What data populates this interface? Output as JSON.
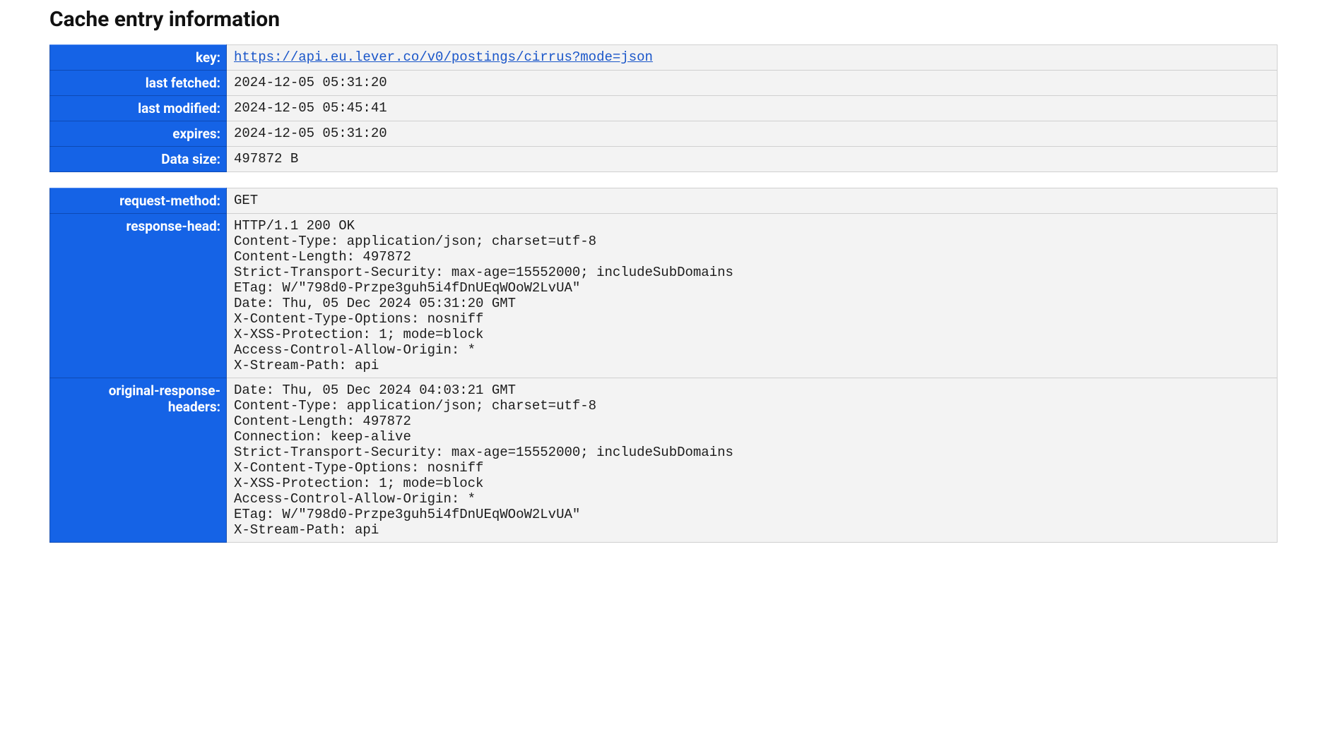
{
  "title": "Cache entry information",
  "entry": {
    "rows": [
      {
        "label": "key:",
        "value": "https://api.eu.lever.co/v0/postings/cirrus?mode=json",
        "is_link": true
      },
      {
        "label": "last fetched:",
        "value": "2024-12-05 05:31:20"
      },
      {
        "label": "last modified:",
        "value": "2024-12-05 05:45:41"
      },
      {
        "label": "expires:",
        "value": "2024-12-05 05:31:20"
      },
      {
        "label": "Data size:",
        "value": "497872 B"
      }
    ]
  },
  "meta": {
    "rows": [
      {
        "label": "request-method:",
        "value": "GET"
      },
      {
        "label": "response-head:",
        "value": "HTTP/1.1 200 OK\nContent-Type: application/json; charset=utf-8\nContent-Length: 497872\nStrict-Transport-Security: max-age=15552000; includeSubDomains\nETag: W/\"798d0-Przpe3guh5i4fDnUEqWOoW2LvUA\"\nDate: Thu, 05 Dec 2024 05:31:20 GMT\nX-Content-Type-Options: nosniff\nX-XSS-Protection: 1; mode=block\nAccess-Control-Allow-Origin: *\nX-Stream-Path: api"
      },
      {
        "label": "original-response-headers:",
        "value": "Date: Thu, 05 Dec 2024 04:03:21 GMT\nContent-Type: application/json; charset=utf-8\nContent-Length: 497872\nConnection: keep-alive\nStrict-Transport-Security: max-age=15552000; includeSubDomains\nX-Content-Type-Options: nosniff\nX-XSS-Protection: 1; mode=block\nAccess-Control-Allow-Origin: *\nETag: W/\"798d0-Przpe3guh5i4fDnUEqWOoW2LvUA\"\nX-Stream-Path: api"
      }
    ]
  }
}
